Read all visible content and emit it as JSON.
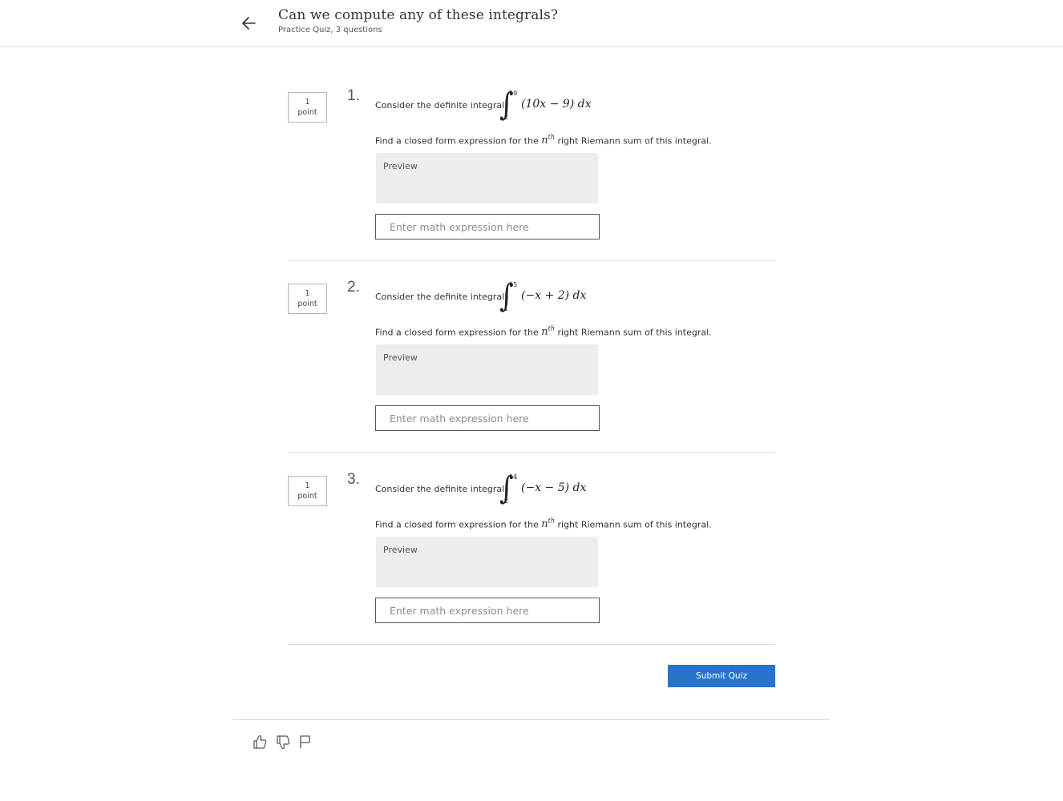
{
  "header": {
    "title": "Can we compute any of these integrals?",
    "subtitle": "Practice Quiz, 3 questions",
    "back_icon": "arrow-left-icon"
  },
  "questions": [
    {
      "number": "1.",
      "points_value": "1",
      "points_unit": "point",
      "prompt": "Consider the definite integral",
      "integral": {
        "upper": "19",
        "lower": "2",
        "body": "(10x − 9) dx"
      },
      "find_prefix": "Find a closed form expression for the ",
      "find_n": "n",
      "find_sup": "th",
      "find_suffix": " right Riemann sum of this integral.",
      "preview_label": "Preview",
      "input_value": "",
      "input_placeholder": "Enter math expression here"
    },
    {
      "number": "2.",
      "points_value": "1",
      "points_unit": "point",
      "prompt": "Consider the definite integral",
      "integral": {
        "upper": "15",
        "lower": "1",
        "body": "(−x + 2) dx"
      },
      "find_prefix": "Find a closed form expression for the ",
      "find_n": "n",
      "find_sup": "th",
      "find_suffix": " right Riemann sum of this integral.",
      "preview_label": "Preview",
      "input_value": "",
      "input_placeholder": "Enter math expression here"
    },
    {
      "number": "3.",
      "points_value": "1",
      "points_unit": "point",
      "prompt": "Consider the definite integral",
      "integral": {
        "upper": "14",
        "lower": "2",
        "body": "(−x − 5) dx"
      },
      "find_prefix": "Find a closed form expression for the ",
      "find_n": "n",
      "find_sup": "th",
      "find_suffix": " right Riemann sum of this integral.",
      "preview_label": "Preview",
      "input_value": "",
      "input_placeholder": "Enter math expression here"
    }
  ],
  "submit": {
    "label": "Submit Quiz",
    "color": "#2a73cc"
  },
  "footer": {
    "icons": [
      "thumbs-up-icon",
      "thumbs-down-icon",
      "flag-icon"
    ]
  }
}
